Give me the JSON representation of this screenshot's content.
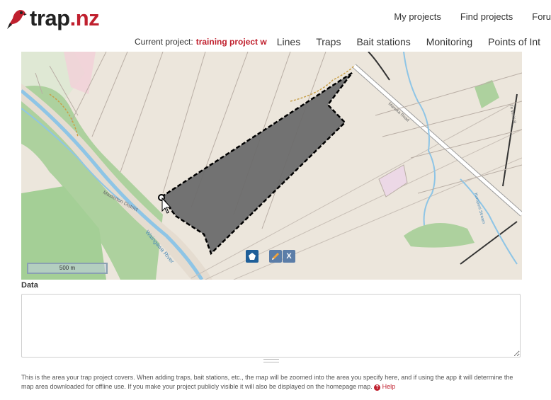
{
  "brand": {
    "logo_main": "trap",
    "logo_suffix": ".nz"
  },
  "top_nav": [
    "My projects",
    "Find projects",
    "Foru"
  ],
  "project_bar": {
    "label": "Current project:",
    "name": "training project w",
    "tabs": [
      "Lines",
      "Traps",
      "Bait stations",
      "Monitoring",
      "Points of Int"
    ]
  },
  "map": {
    "scale_label": "500 m",
    "labels": {
      "road": "Manuka Road",
      "river": "Waingawa River",
      "district": "Masterton District",
      "stream": "Kurupuni Stream",
      "road2": "Te Whiti R"
    },
    "tools": {
      "polygon_icon": "pentagon-icon",
      "edit_icon": "edit-pencil-icon",
      "delete_label": "X"
    },
    "colors": {
      "polygon_fill": "#6b6b6b",
      "polygon_stroke": "#000000",
      "water": "#8ec5e6",
      "forest": "#add19e",
      "land": "#ece6dc"
    }
  },
  "data_field": {
    "label": "Data",
    "value": ""
  },
  "help": {
    "text": "This is the area your trap project covers. When adding traps, bait stations, etc., the map will be zoomed into the area you specify here, and if using the app it will determine the map area downloaded for offline use. If you make your project publicly visible it will also be displayed on the homepage map.",
    "link": "Help"
  }
}
